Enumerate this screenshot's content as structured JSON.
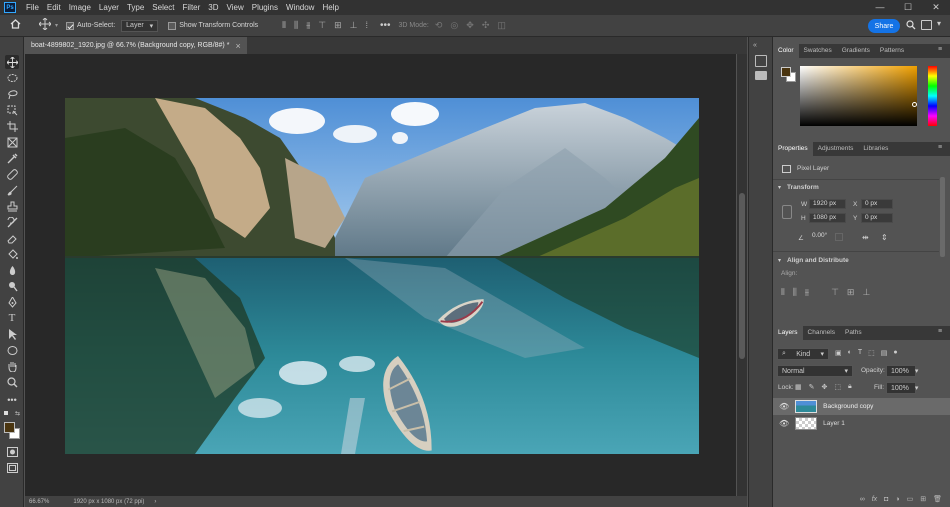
{
  "app": {
    "logo": "Ps"
  },
  "menu": [
    "File",
    "Edit",
    "Image",
    "Layer",
    "Type",
    "Select",
    "Filter",
    "3D",
    "View",
    "Plugins",
    "Window",
    "Help"
  ],
  "window_controls": {
    "minimize": "—",
    "maximize": "☐",
    "close": "✕"
  },
  "options": {
    "auto_select_label": "Auto-Select:",
    "auto_select_target": "Layer",
    "show_transform_label": "Show Transform Controls",
    "mode_label": "3D Mode:",
    "share_label": "Share"
  },
  "document": {
    "tab_title": "boat-4899802_1920.jpg @ 66.7% (Background copy, RGB/8#) *",
    "close": "×"
  },
  "status": {
    "zoom": "66.67%",
    "info": "1920 px x 1080 px (72 ppi)"
  },
  "color_panel": {
    "tabs": [
      "Color",
      "Swatches",
      "Gradients",
      "Patterns"
    ],
    "foreground": "#4a3510",
    "background": "#ffffff"
  },
  "properties": {
    "tabs": [
      "Properties",
      "Adjustments",
      "Libraries"
    ],
    "layer_type": "Pixel Layer",
    "transform_title": "Transform",
    "w_label": "W",
    "w_value": "1920 px",
    "x_label": "X",
    "x_value": "0 px",
    "h_label": "H",
    "h_value": "1080 px",
    "y_label": "Y",
    "y_value": "0 px",
    "angle": "0.00°",
    "align_title": "Align and Distribute",
    "align_label": "Align:"
  },
  "layers": {
    "tabs": [
      "Layers",
      "Channels",
      "Paths"
    ],
    "filter_label": "Kind",
    "blend_mode": "Normal",
    "opacity_label": "Opacity:",
    "opacity_value": "100%",
    "lock_label": "Lock:",
    "fill_label": "Fill:",
    "fill_value": "100%",
    "items": [
      {
        "name": "Background copy",
        "selected": true
      },
      {
        "name": "Layer 1",
        "selected": false
      }
    ]
  }
}
